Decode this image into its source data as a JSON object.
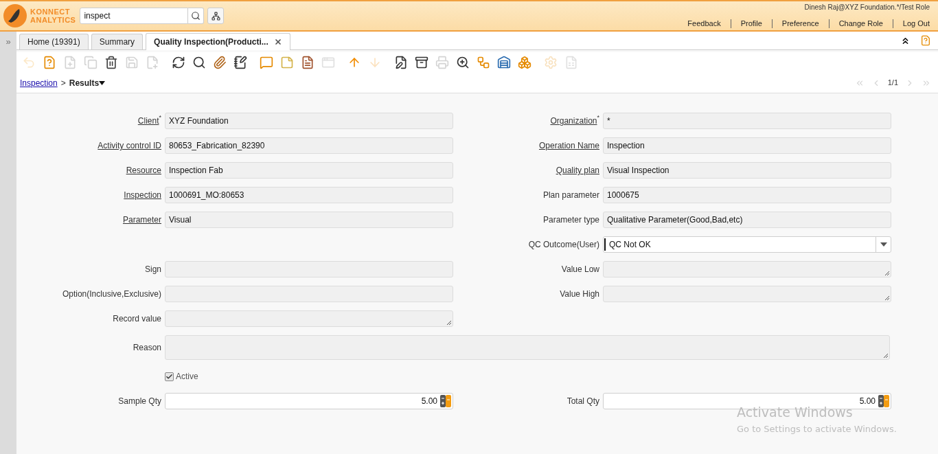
{
  "header": {
    "brand": [
      "KONNECT",
      "ANALYTICS"
    ],
    "search": {
      "value": "inspect"
    },
    "user": "Dinesh Raj@XYZ Foundation.*/Test Role",
    "links": [
      "Feedback",
      "Profile",
      "Preference",
      "Change Role",
      "Log Out"
    ]
  },
  "side_toggle": "»",
  "tabs": [
    {
      "label": "Home (19391)",
      "selected": false,
      "closable": false
    },
    {
      "label": "Summary",
      "selected": false,
      "closable": false
    },
    {
      "label": "Quality Inspection(Producti...",
      "selected": true,
      "closable": true
    }
  ],
  "toolbar": [
    {
      "disabled": true
    },
    {
      "disabled": false
    },
    {
      "disabled": true
    },
    {
      "disabled": true
    },
    {
      "disabled": false
    },
    {
      "disabled": true
    },
    {
      "disabled": true
    },
    {
      "disabled": false
    },
    {
      "disabled": false
    },
    {
      "disabled": false
    },
    {
      "disabled": false
    },
    {
      "disabled": false
    },
    {
      "disabled": false
    },
    {
      "disabled": false
    },
    {
      "disabled": true
    },
    {
      "disabled": false
    },
    {
      "disabled": true
    },
    {
      "disabled": false
    },
    {
      "disabled": false
    },
    {
      "disabled": true
    },
    {
      "disabled": false
    },
    {
      "disabled": false
    },
    {
      "disabled": false
    },
    {
      "disabled": false
    },
    {
      "disabled": true
    },
    {
      "disabled": true
    }
  ],
  "breadcrumb": {
    "link": "Inspection",
    "separator": ">",
    "current": "Results"
  },
  "pager": {
    "text": "1/1",
    "first_disabled": true,
    "last_disabled": true
  },
  "form": {
    "rows": [
      {
        "left": {
          "label": "Client",
          "link": true,
          "mark": "*",
          "kind": "text",
          "readonly": true,
          "value": "XYZ Foundation"
        },
        "right": {
          "label": "Organization",
          "link": true,
          "mark": "*",
          "kind": "text",
          "readonly": true,
          "value": "*"
        }
      },
      {
        "left": {
          "label": "Activity control ID",
          "link": true,
          "kind": "text",
          "readonly": true,
          "value": "80653_Fabrication_82390"
        },
        "right": {
          "label": "Operation Name",
          "link": true,
          "kind": "text",
          "readonly": true,
          "value": "Inspection"
        }
      },
      {
        "left": {
          "label": "Resource",
          "link": true,
          "kind": "text",
          "readonly": true,
          "value": "Inspection Fab"
        },
        "right": {
          "label": "Quality plan",
          "link": true,
          "kind": "text",
          "readonly": true,
          "value": "Visual Inspection"
        }
      },
      {
        "left": {
          "label": "Inspection",
          "link": true,
          "kind": "text",
          "readonly": true,
          "value": "1000691_MO:80653"
        },
        "right": {
          "label": "Plan parameter",
          "link": false,
          "kind": "text",
          "readonly": true,
          "value": "1000675"
        }
      },
      {
        "left": {
          "label": "Parameter",
          "link": true,
          "kind": "text",
          "readonly": true,
          "value": "Visual"
        },
        "right": {
          "label": "Parameter type",
          "link": false,
          "kind": "text",
          "readonly": true,
          "value": "Qualitative Parameter(Good,Bad,etc)"
        }
      },
      {
        "right": {
          "label": "QC Outcome(User)",
          "link": false,
          "kind": "select",
          "readonly": false,
          "value": "QC Not OK"
        }
      },
      {
        "left": {
          "label": "Sign",
          "link": false,
          "kind": "text",
          "readonly": true
        },
        "right": {
          "label": "Value Low",
          "link": false,
          "kind": "textarea",
          "readonly": true
        }
      },
      {
        "left": {
          "label": "Option(Inclusive,Exclusive)",
          "link": false,
          "kind": "text",
          "readonly": true
        },
        "right": {
          "label": "Value High",
          "link": false,
          "kind": "textarea",
          "readonly": true
        }
      },
      {
        "left": {
          "label": "Record value",
          "link": false,
          "kind": "textarea",
          "readonly": true
        }
      },
      {
        "wide": {
          "label": "Reason",
          "link": false,
          "kind": "textarea",
          "readonly": true
        }
      },
      {
        "left": {
          "label": "Active",
          "kind": "checkbox",
          "checked": true
        }
      },
      {
        "left": {
          "label": "Sample Qty",
          "link": false,
          "kind": "number",
          "readonly": false,
          "value": "5.00"
        },
        "right": {
          "label": "Total Qty",
          "link": false,
          "kind": "number",
          "readonly": false,
          "value": "5.00"
        }
      }
    ]
  },
  "os_overlay": {
    "title": "Activate Windows",
    "subtitle": "Go to Settings to activate Windows."
  }
}
